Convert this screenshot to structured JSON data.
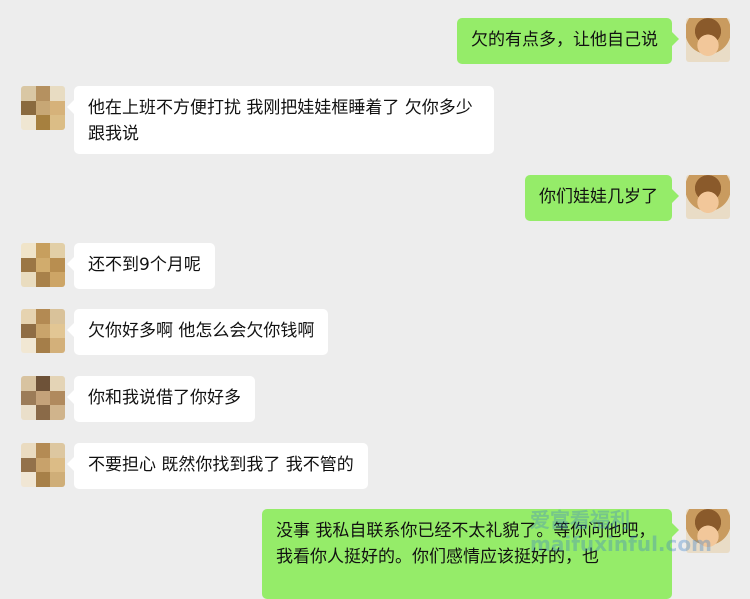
{
  "messages": [
    {
      "side": "out",
      "text": "欠的有点多，让他自己说"
    },
    {
      "side": "in",
      "text": "他在上班不方便打扰 我刚把娃娃框睡着了 欠你多少跟我说"
    },
    {
      "side": "out",
      "text": "你们娃娃几岁了"
    },
    {
      "side": "in",
      "text": "还不到9个月呢"
    },
    {
      "side": "in",
      "text": "欠你好多啊 他怎么会欠你钱啊"
    },
    {
      "side": "in",
      "text": "你和我说借了你好多"
    },
    {
      "side": "in",
      "text": "不要担心 既然你找到我了 我不管的"
    },
    {
      "side": "out",
      "text": "没事 我私自联系你已经不太礼貌了。等你问他吧，我看你人挺好的。你们感情应该挺好的，也"
    }
  ],
  "avatars": {
    "self_icon": "user-photo-avatar",
    "contact_icon": "pixelated-avatar"
  },
  "watermark": {
    "line1": "爱富看福利",
    "line2": "maifuxinful.com"
  },
  "colors": {
    "background": "#ededed",
    "outgoing_bubble": "#95ec69",
    "incoming_bubble": "#ffffff"
  }
}
